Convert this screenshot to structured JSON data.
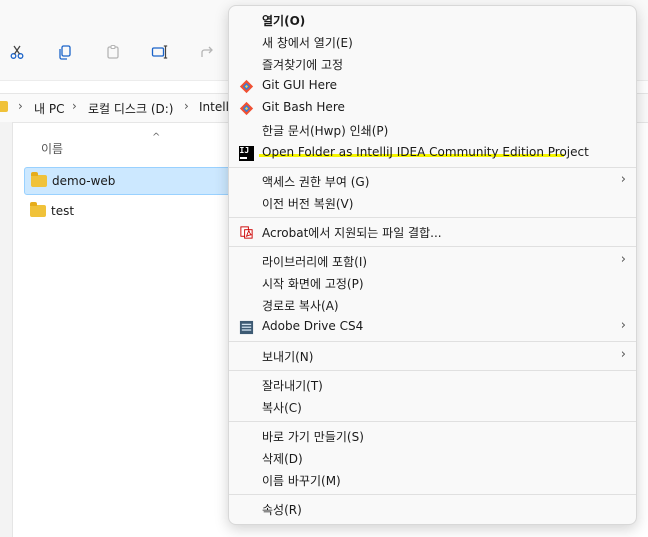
{
  "toolbar": {
    "icons": [
      "cut-icon",
      "copy-icon",
      "paste-icon",
      "rename-icon",
      "share-icon"
    ]
  },
  "address": {
    "crumbs": [
      "내 PC",
      "로컬 디스크 (D:)",
      "Intelli"
    ]
  },
  "file_list": {
    "column_name": "이름",
    "sort_indicator": "^",
    "items": [
      {
        "label": "demo-web",
        "selected": true
      },
      {
        "label": "test",
        "selected": false
      }
    ]
  },
  "context_menu": {
    "items": [
      {
        "label": "열기(O)",
        "bold": true
      },
      {
        "label": "새 창에서 열기(E)"
      },
      {
        "label": "즐겨찾기에 고정"
      },
      {
        "label": "Git GUI Here",
        "icon": "git-icon"
      },
      {
        "label": "Git Bash Here",
        "icon": "git-icon"
      },
      {
        "label": "한글 문서(Hwp) 인쇄(P)"
      },
      {
        "label": "Open Folder as IntelliJ IDEA Community Edition Project",
        "icon": "intellij-icon",
        "highlight_color": "#f5f500"
      },
      {
        "label": "액세스 권한 부여 (G)",
        "submenu": true
      },
      {
        "label": "이전 버전 복원(V)"
      },
      {
        "label": "Acrobat에서 지원되는 파일 결합...",
        "icon": "acrobat-icon"
      },
      {
        "label": "라이브러리에 포함(I)",
        "submenu": true
      },
      {
        "label": "시작 화면에 고정(P)"
      },
      {
        "label": "경로로 복사(A)"
      },
      {
        "label": "Adobe Drive CS4",
        "icon": "adobe-drive-icon",
        "submenu": true
      },
      {
        "label": "보내기(N)",
        "submenu": true
      },
      {
        "label": "잘라내기(T)"
      },
      {
        "label": "복사(C)"
      },
      {
        "label": "바로 가기 만들기(S)"
      },
      {
        "label": "삭제(D)"
      },
      {
        "label": "이름 바꾸기(M)"
      },
      {
        "label": "속성(R)"
      }
    ],
    "submenu_arrow": "›",
    "intellij_icon_text": "IJ"
  },
  "colors": {
    "selection": "#cce8ff",
    "highlight": "#f5f500",
    "folder": "#f0c23a"
  }
}
